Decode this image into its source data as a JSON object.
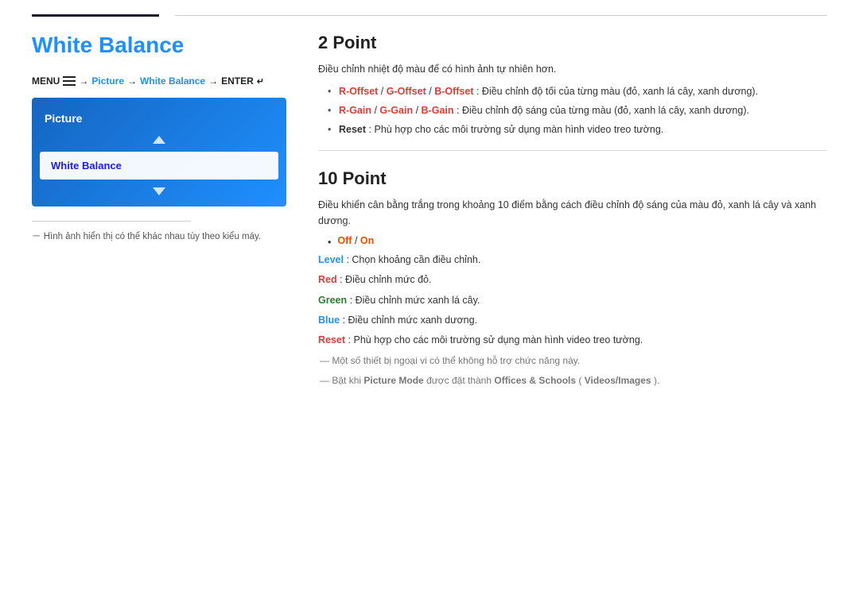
{
  "topbar": {
    "left_line": true,
    "right_line": true
  },
  "left": {
    "page_title": "White Balance",
    "menu_path": {
      "parts": [
        "MENU",
        "→",
        "Picture",
        "→",
        "White Balance",
        "→",
        "ENTER"
      ]
    },
    "picture_menu": {
      "header": "Picture",
      "selected_item": "White Balance"
    },
    "footnote": "－ Hình ảnh hiển thị có thể khác nhau tùy theo kiểu máy."
  },
  "right": {
    "section1": {
      "title": "2 Point",
      "desc": "Điều chỉnh nhiệt độ màu để có hình ảnh tự nhiên hơn.",
      "bullets": [
        {
          "prefix_bold_red": "R-Offset",
          "sep1": " / ",
          "mid1_bold_red": "G-Offset",
          "sep2": " / ",
          "mid2_bold_red": "B-Offset",
          "rest": ": Điều chỉnh độ tối của từng màu (đỏ, xanh lá cây, xanh dương)."
        },
        {
          "prefix_bold_red": "R-Gain",
          "sep1": " / ",
          "mid1_bold_red": "G-Gain",
          "sep2": " / ",
          "mid2_bold_red": "B-Gain",
          "rest": ": Điều chỉnh độ sáng của từng màu (đỏ, xanh lá cây, xanh dương)."
        },
        {
          "prefix_bold": "Reset",
          "rest": ": Phù hợp cho các môi trường sử dụng màn hình video treo tường."
        }
      ]
    },
    "section2": {
      "title": "10 Point",
      "desc": "Điều khiển cân bằng trắng trong khoảng 10 điểm bằng cách điều chỉnh độ sáng của màu đỏ, xanh lá cây và xanh dương.",
      "inline_bullet": {
        "dot": "•",
        "bold_orange": "Off",
        "sep": " / ",
        "bold_orange2": "On"
      },
      "params": [
        {
          "bold_blue": "Level",
          "rest": ": Chọn khoảng cần điều chỉnh."
        },
        {
          "bold_red": "Red",
          "rest": ": Điều chỉnh mức đỏ."
        },
        {
          "bold_green": "Green",
          "rest": ": Điều chỉnh mức xanh lá cây."
        },
        {
          "bold_blue2": "Blue",
          "rest": ": Điều chỉnh mức xanh dương."
        },
        {
          "bold_red2": "Reset",
          "rest": ": Phù hợp cho các môi trường sử dụng màn hình video treo tường."
        }
      ],
      "notes": [
        "Một số thiết bị ngoại vi có thể không hỗ trợ chức năng này.",
        {
          "prefix": "Bật khi ",
          "bold1": "Picture Mode",
          "mid": " được đặt thành ",
          "bold2": "Offices & Schools",
          "paren_open": " (",
          "bold3": "Videos/Images",
          "paren_close": ")."
        }
      ]
    }
  }
}
